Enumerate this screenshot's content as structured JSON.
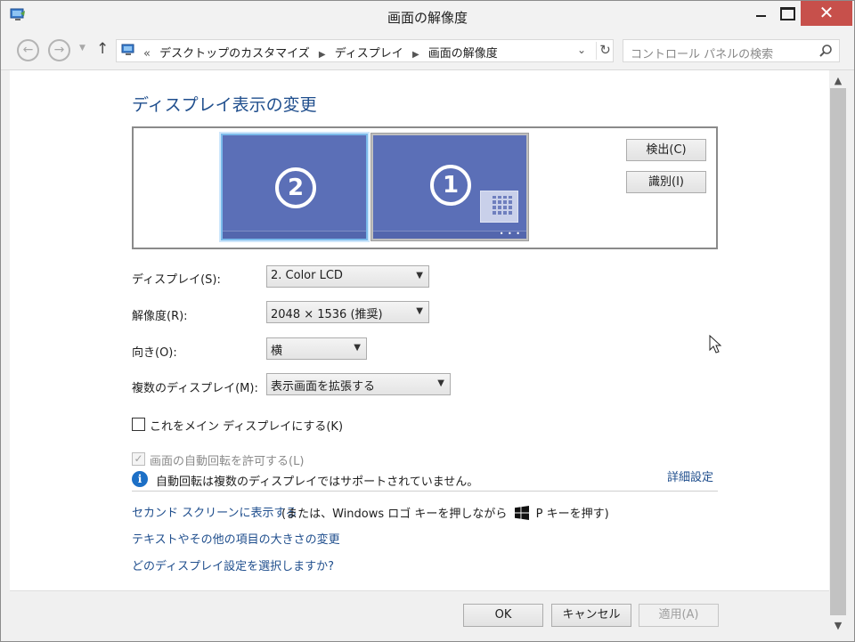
{
  "window": {
    "title": "画面の解像度"
  },
  "address_bar": {
    "overflow": "«",
    "crumbs": [
      "デスクトップのカスタマイズ",
      "ディスプレイ",
      "画面の解像度"
    ],
    "search_placeholder": "コントロール パネルの検索"
  },
  "main": {
    "heading": "ディスプレイ表示の変更",
    "monitors": [
      {
        "number": "2"
      },
      {
        "number": "1"
      }
    ],
    "detect_label": "検出(C)",
    "identify_label": "識別(I)",
    "display_label": "ディスプレイ(S):",
    "display_value": "2. Color LCD",
    "resolution_label": "解像度(R):",
    "resolution_value": "2048 × 1536 (推奨)",
    "orientation_label": "向き(O):",
    "orientation_value": "横",
    "multi_display_label": "複数のディスプレイ(M):",
    "multi_display_value": "表示画面を拡張する",
    "make_main_label": "これをメイン ディスプレイにする(K)",
    "auto_rotate_label": "画面の自動回転を許可する(L)",
    "info_text": "自動回転は複数のディスプレイではサポートされていません。",
    "advanced_link": "詳細設定",
    "second_screen_link": "セカンド スクリーンに表示する",
    "second_screen_hint_pre": "(または、Windows ロゴ キーを押しながら",
    "second_screen_hint_post": "P キーを押す)",
    "text_size_link": "テキストやその他の項目の大きさの変更",
    "which_settings_link": "どのディスプレイ設定を選択しますか?"
  },
  "footer": {
    "ok_label": "OK",
    "cancel_label": "キャンセル",
    "apply_label": "適用(A)"
  },
  "colors": {
    "link": "#1f4e8d",
    "monitor": "#5b6fb7",
    "close": "#c7504b"
  }
}
